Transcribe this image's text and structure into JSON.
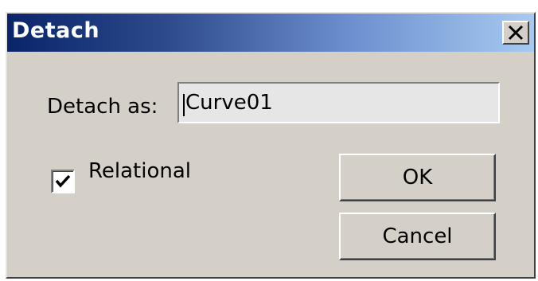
{
  "window": {
    "title": "Detach",
    "close_glyph": "✕"
  },
  "form": {
    "detach_as_label": "Detach as:",
    "detach_as_value": "Curve01",
    "relational_label": "Relational",
    "relational_checked": true
  },
  "buttons": {
    "ok_label": "OK",
    "cancel_label": "Cancel"
  },
  "icons": {
    "close": "close-icon",
    "check": "checkmark-icon"
  }
}
